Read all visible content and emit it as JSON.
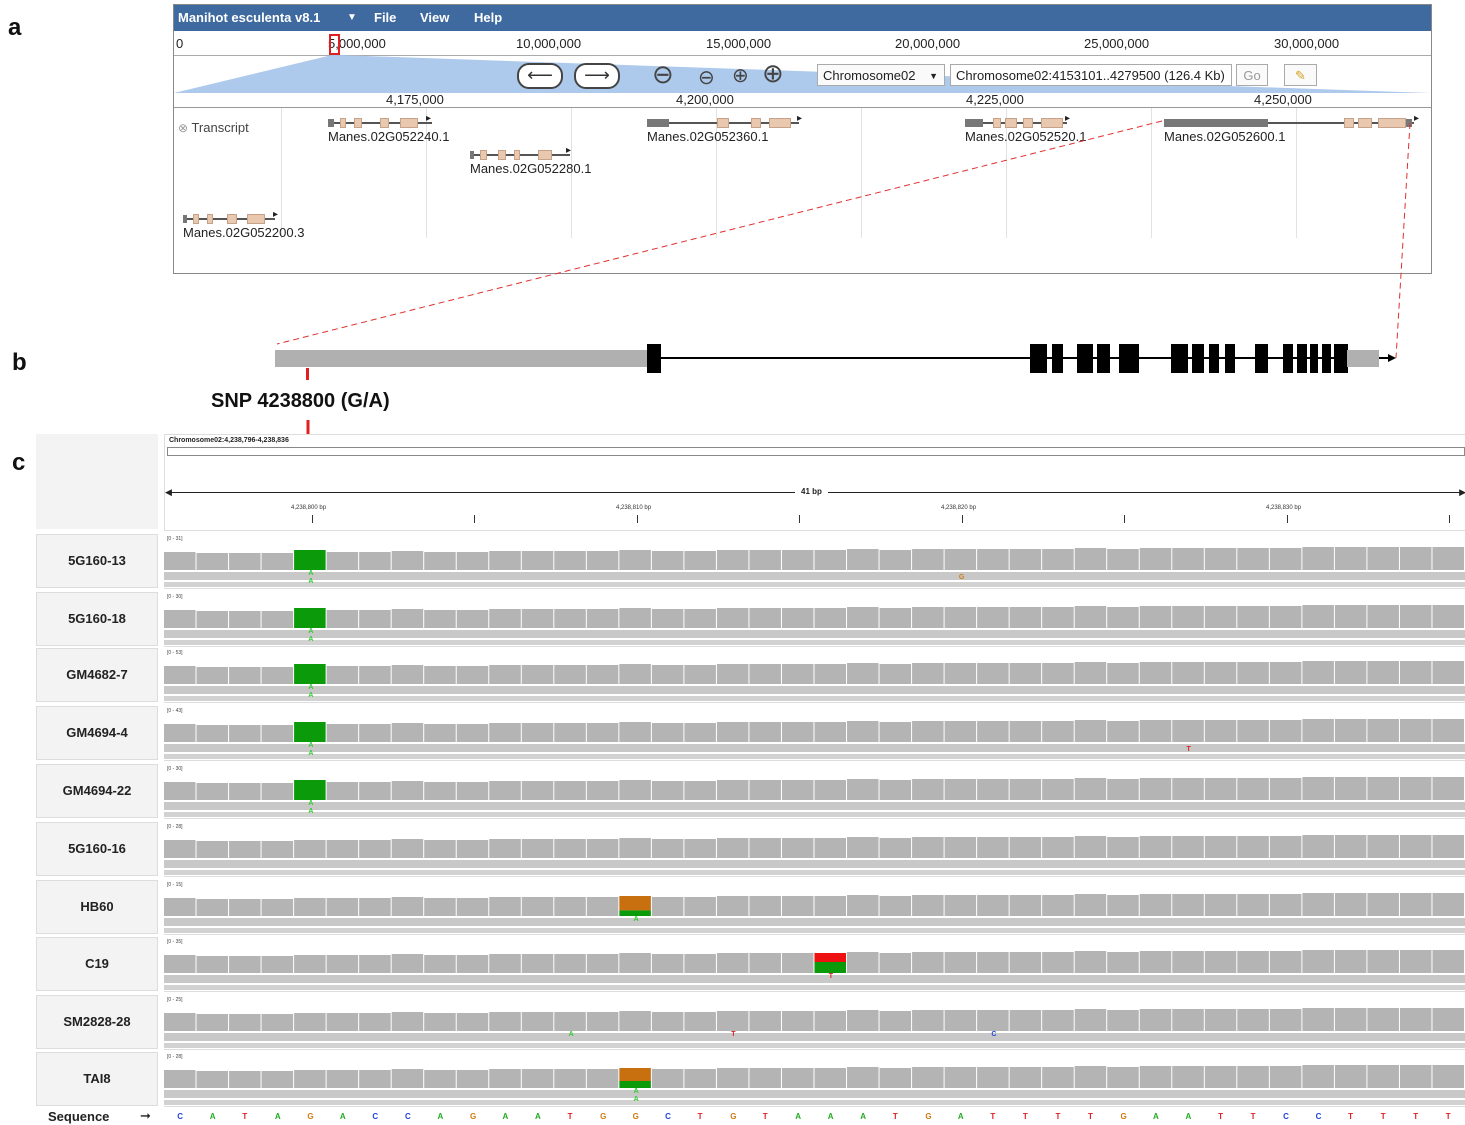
{
  "panels": {
    "a": "a",
    "b": "b",
    "c": "c"
  },
  "jbrowse": {
    "app_title": "Manihot esculenta v8.1",
    "menu": [
      "File",
      "View",
      "Help"
    ],
    "overview_ticks": [
      "0",
      "5,000,000",
      "10,000,000",
      "15,000,000",
      "20,000,000",
      "25,000,000",
      "30,000,000"
    ],
    "chromosome_select": "Chromosome02",
    "location_value": "Chromosome02:4153101..4279500 (126.4 Kb)",
    "go_label": "Go",
    "ruler_ticks": [
      "4,175,000",
      "4,200,000",
      "4,225,000",
      "4,250,000"
    ],
    "track_name": "Transcript",
    "genes": [
      "Manes.02G052240.1",
      "Manes.02G052280.1",
      "Manes.02G052360.1",
      "Manes.02G052520.1",
      "Manes.02G052600.1",
      "Manes.02G052200.3"
    ],
    "colors": {
      "menubar": "#3f6aa0",
      "exon": "#e8c9b0",
      "zoom_region": "#a9c6ea"
    }
  },
  "snp_label": "SNP 4238800 (G/A)",
  "igv": {
    "locus": "Chromosome02:4,238,796-4,238,836",
    "span": "41 bp",
    "ticks": [
      "4,238,800 bp",
      "4,238,810 bp",
      "4,238,820 bp",
      "4,238,830 bp"
    ],
    "samples": [
      {
        "name": "5G160-13",
        "scale": "[0 - 31]"
      },
      {
        "name": "5G160-18",
        "scale": "[0 - 30]"
      },
      {
        "name": "GM4682-7",
        "scale": "[0 - 53]"
      },
      {
        "name": "GM4694-4",
        "scale": "[0 - 43]"
      },
      {
        "name": "GM4694-22",
        "scale": "[0 - 30]"
      },
      {
        "name": "5G160-16",
        "scale": "[0 - 28]"
      },
      {
        "name": "HB60",
        "scale": "[0 - 15]"
      },
      {
        "name": "C19",
        "scale": "[0 - 35]"
      },
      {
        "name": "SM2828-28",
        "scale": "[0 - 25]"
      },
      {
        "name": "TAI8",
        "scale": "[0 - 28]"
      }
    ],
    "sequence_label": "Sequence",
    "sequence": [
      "C",
      "A",
      "T",
      "A",
      "G",
      "A",
      "C",
      "C",
      "A",
      "G",
      "A",
      "A",
      "T",
      "G",
      "G",
      "C",
      "T",
      "G",
      "T",
      "A",
      "A",
      "A",
      "T",
      "G",
      "A",
      "T",
      "T",
      "T",
      "T",
      "G",
      "A",
      "A",
      "T",
      "T",
      "C",
      "C",
      "T",
      "T",
      "T",
      "T"
    ],
    "base_colors": {
      "A": "#22aa22",
      "C": "#2244dd",
      "G": "#d07a10",
      "T": "#dd2222"
    },
    "colors": {
      "coverage": "#b4b4b4",
      "alt_A": "#0a9a0a",
      "alt_G": "#c87010",
      "alt_T": "#ee1111"
    }
  }
}
